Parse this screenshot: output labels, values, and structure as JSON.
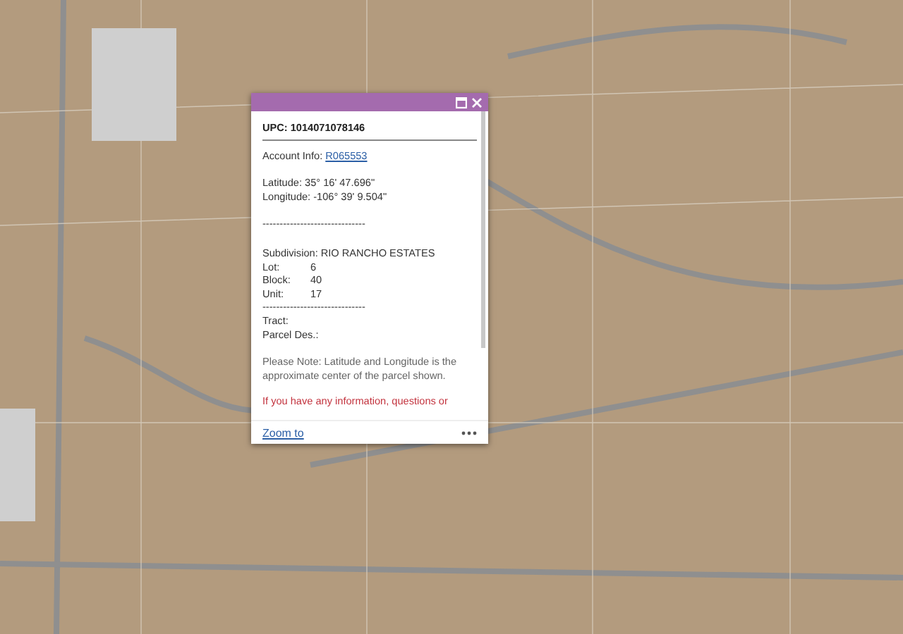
{
  "popup": {
    "title": "UPC: 1014071078146",
    "account": {
      "label": "Account Info:",
      "link": "R065553"
    },
    "coordinates": [
      "Latitude: 35° 16' 47.696\"",
      "Longitude: -106° 39' 9.504\""
    ],
    "separator": "------------------------------",
    "subdivision": "Subdivision: RIO RANCHO ESTATES",
    "fields": [
      {
        "label": "Lot:",
        "value": "6"
      },
      {
        "label": "Block:",
        "value": "40"
      },
      {
        "label": "Unit:",
        "value": "17"
      }
    ],
    "separator_2": "------------------------------",
    "tract": "Tract:",
    "parcel_description": "Parcel Des.:",
    "note": "Please Note: Latitude and Longitude is the approximate center of the parcel shown.",
    "info": "If you have any information, questions or",
    "zoom_link": "Zoom to"
  }
}
